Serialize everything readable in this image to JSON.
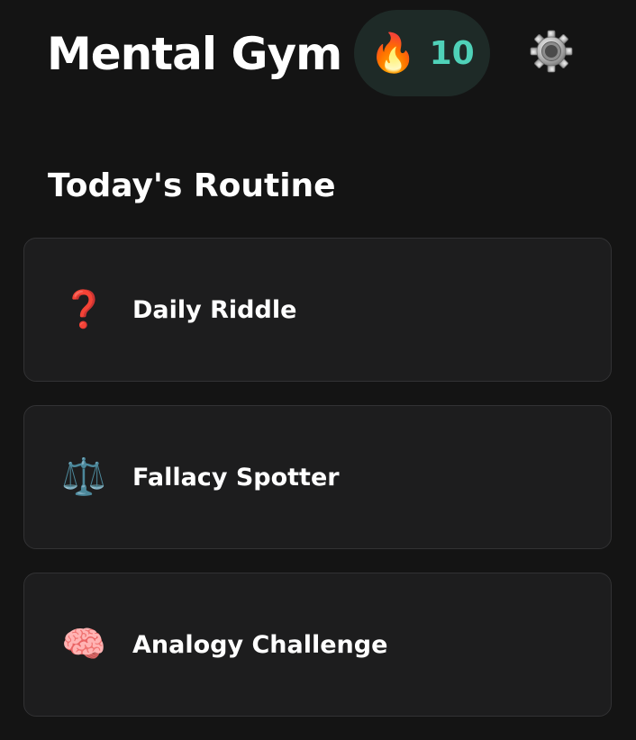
{
  "header": {
    "app_title": "Mental Gym",
    "streak": {
      "icon": "fire-icon",
      "count": "10",
      "accent_color": "#4fd1b8"
    },
    "settings_icon": "gear-icon"
  },
  "routine": {
    "section_title": "Today's Routine",
    "items": [
      {
        "label": "Daily Riddle",
        "icon": "question-mark-icon",
        "glyph": "❓"
      },
      {
        "label": "Fallacy Spotter",
        "icon": "balance-scale-icon",
        "glyph": "⚖️"
      },
      {
        "label": "Analogy Challenge",
        "icon": "brain-icon",
        "glyph": "🧠"
      }
    ]
  },
  "colors": {
    "background": "#141414",
    "card_background": "#1d1d1e",
    "card_border": "#323234",
    "badge_background": "#1e2a27"
  }
}
